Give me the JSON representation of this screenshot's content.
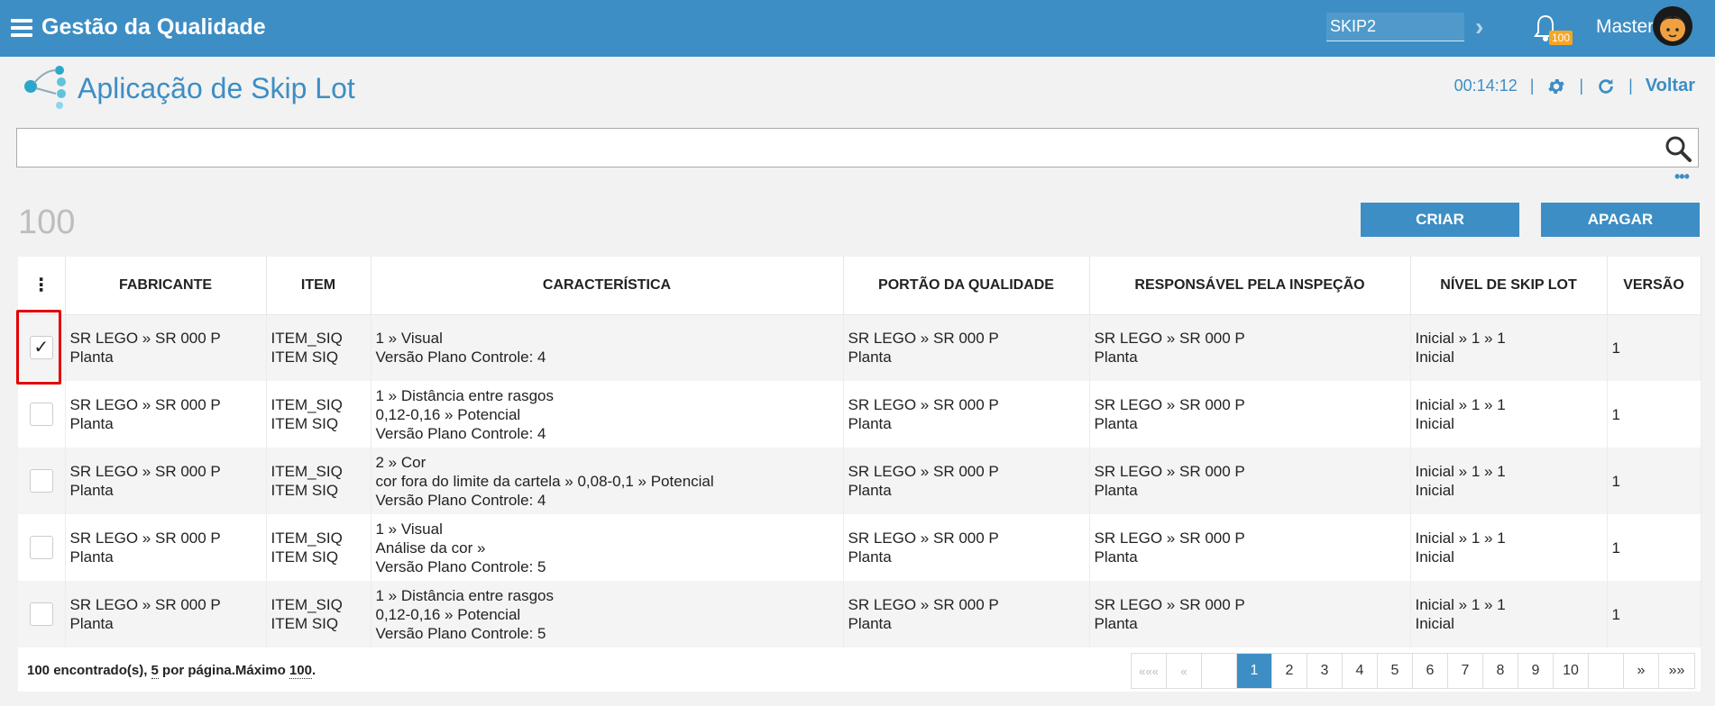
{
  "topbar": {
    "title": "Gestão da Qualidade",
    "skip_value": "SKIP2",
    "badge": "100",
    "user": "Master"
  },
  "header": {
    "title": "Aplicação de Skip Lot",
    "timer": "00:14:12",
    "back": "Voltar"
  },
  "search": {
    "placeholder": ""
  },
  "total": "100",
  "buttons": {
    "create": "CRIAR",
    "delete": "APAGAR"
  },
  "columns": [
    "FABRICANTE",
    "ITEM",
    "CARACTERÍSTICA",
    "PORTÃO DA QUALIDADE",
    "RESPONSÁVEL PELA INSPEÇÃO",
    "NÍVEL DE SKIP LOT",
    "VERSÃO"
  ],
  "rows": [
    {
      "checked": true,
      "fab1": "SR LEGO » SR 000 P",
      "fab2": "Planta",
      "item1": "ITEM_SIQ",
      "item2": "ITEM SIQ",
      "car1": "1 » Visual",
      "car2": "Versão Plano Controle: 4",
      "car3": "",
      "portao1": "SR LEGO » SR 000 P",
      "portao2": "Planta",
      "resp1": "SR LEGO » SR 000 P",
      "resp2": "Planta",
      "nivel1": "Inicial » 1 » 1",
      "nivel2": "Inicial",
      "versao": "1"
    },
    {
      "checked": false,
      "fab1": "SR LEGO » SR 000 P",
      "fab2": "Planta",
      "item1": "ITEM_SIQ",
      "item2": "ITEM SIQ",
      "car1": "1 » Distância entre rasgos",
      "car2": "0,12-0,16 » Potencial",
      "car3": "Versão Plano Controle: 4",
      "portao1": "SR LEGO » SR 000 P",
      "portao2": "Planta",
      "resp1": "SR LEGO » SR 000 P",
      "resp2": "Planta",
      "nivel1": "Inicial » 1 » 1",
      "nivel2": "Inicial",
      "versao": "1"
    },
    {
      "checked": false,
      "fab1": "SR LEGO » SR 000 P",
      "fab2": "Planta",
      "item1": "ITEM_SIQ",
      "item2": "ITEM SIQ",
      "car1": "2 » Cor",
      "car2": "cor fora do limite da cartela » 0,08-0,1 » Potencial",
      "car3": "Versão Plano Controle: 4",
      "portao1": "SR LEGO » SR 000 P",
      "portao2": "Planta",
      "resp1": "SR LEGO » SR 000 P",
      "resp2": "Planta",
      "nivel1": "Inicial » 1 » 1",
      "nivel2": "Inicial",
      "versao": "1"
    },
    {
      "checked": false,
      "fab1": "SR LEGO » SR 000 P",
      "fab2": "Planta",
      "item1": "ITEM_SIQ",
      "item2": "ITEM SIQ",
      "car1": "1 » Visual",
      "car2": "Análise da cor »",
      "car3": "Versão Plano Controle: 5",
      "portao1": "SR LEGO » SR 000 P",
      "portao2": "Planta",
      "resp1": "SR LEGO » SR 000 P",
      "resp2": "Planta",
      "nivel1": "Inicial » 1 » 1",
      "nivel2": "Inicial",
      "versao": "1"
    },
    {
      "checked": false,
      "fab1": "SR LEGO » SR 000 P",
      "fab2": "Planta",
      "item1": "ITEM_SIQ",
      "item2": "ITEM SIQ",
      "car1": "1 » Distância entre rasgos",
      "car2": "0,12-0,16 » Potencial",
      "car3": "Versão Plano Controle: 5",
      "portao1": "SR LEGO » SR 000 P",
      "portao2": "Planta",
      "resp1": "SR LEGO » SR 000 P",
      "resp2": "Planta",
      "nivel1": "Inicial » 1 » 1",
      "nivel2": "Inicial",
      "versao": "1"
    }
  ],
  "footer": {
    "found": "100",
    "found_label": " encontrado(s), ",
    "per_page": "5",
    "per_page_label": " por página.Máximo ",
    "max": "100",
    "end": "."
  },
  "pager": {
    "first": "«««",
    "prev": "«",
    "pages": [
      "1",
      "2",
      "3",
      "4",
      "5",
      "6",
      "7",
      "8",
      "9",
      "10"
    ],
    "next": "»",
    "last": "»»"
  },
  "colors": {
    "brand": "#3d8ec4",
    "badge": "#f5a623",
    "highlight": "#e30000"
  }
}
